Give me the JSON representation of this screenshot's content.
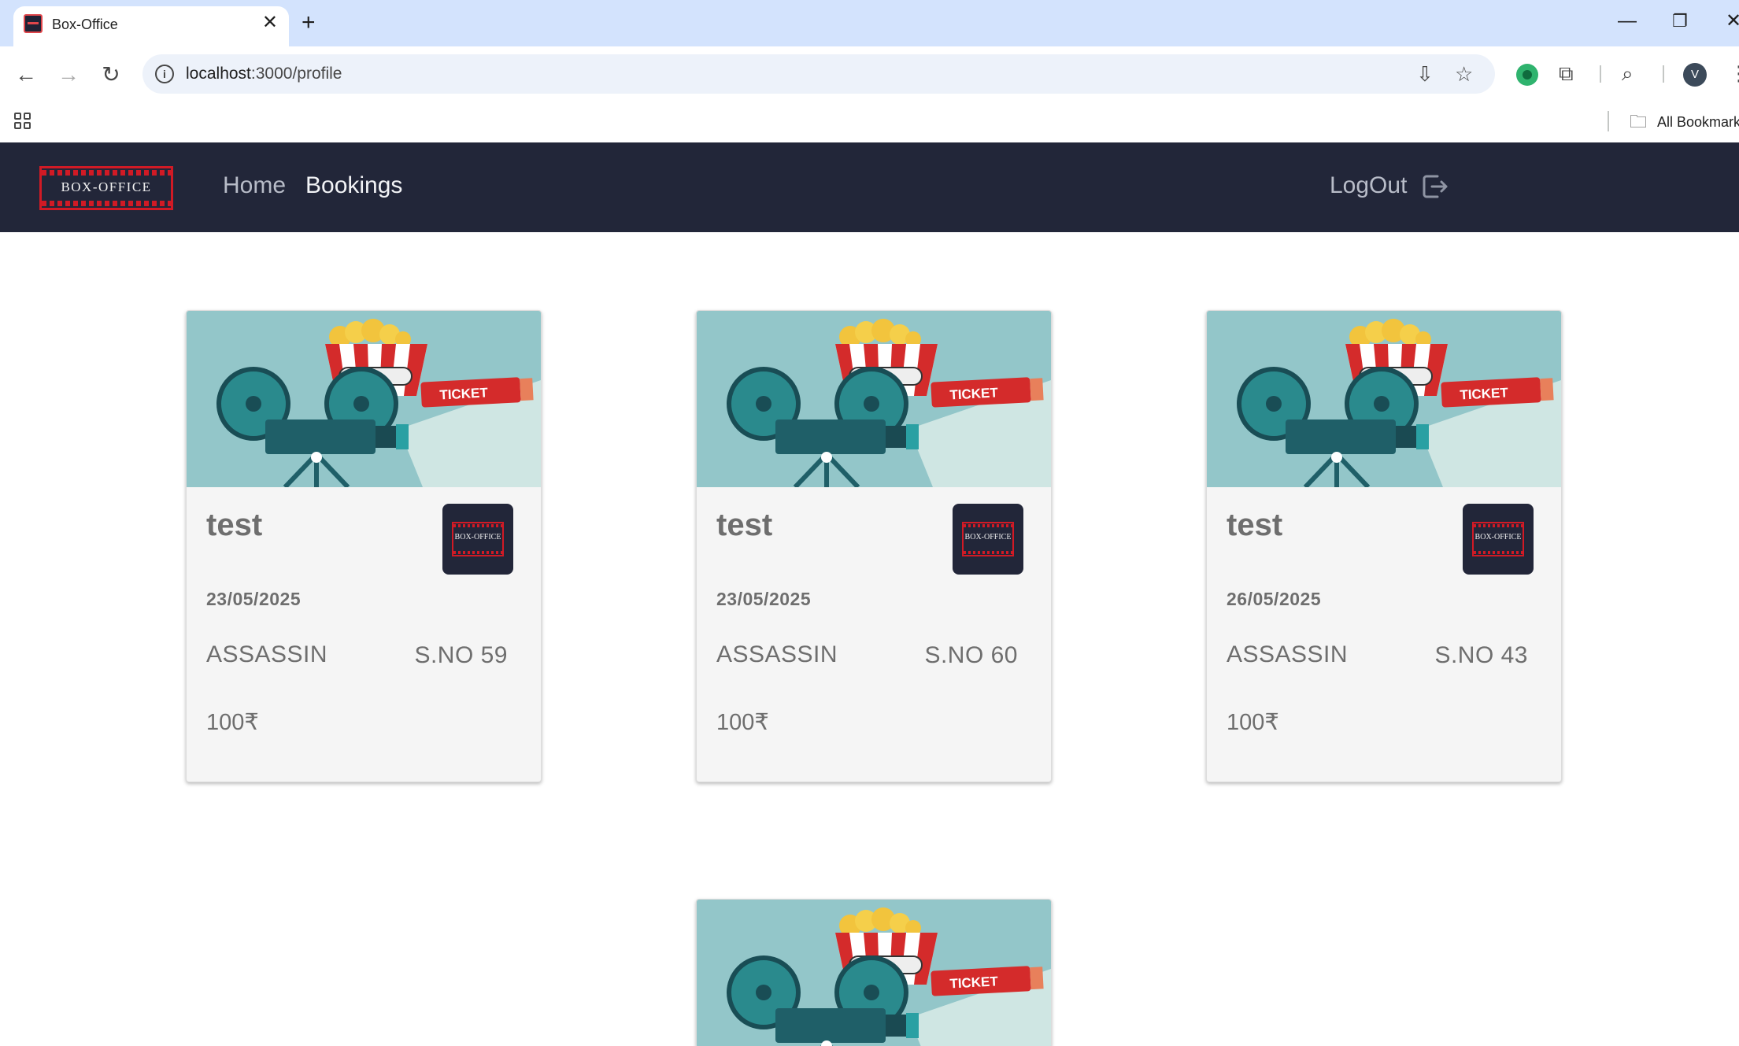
{
  "browser": {
    "tab_title": "Box-Office",
    "tab_close": "✕",
    "new_tab": "+",
    "url_host": "localhost",
    "url_rest": ":3000/profile",
    "all_bookmarks": "All Bookmarks",
    "profile_initial": "V",
    "window_controls": {
      "minimize": "—",
      "restore": "❐",
      "close": "✕"
    }
  },
  "app": {
    "logo_text": "BOX-OFFICE",
    "nav": {
      "home": "Home",
      "bookings": "Bookings"
    },
    "logout_label": "LogOut",
    "colors": {
      "navbar": "#222639",
      "accent": "#d11a25",
      "card_bg": "#f5f5f5",
      "text": "#6e6e6e"
    }
  },
  "bookings": [
    {
      "user": "test",
      "date": "23/05/2025",
      "movie": "ASSASSIN",
      "seat": "S.NO 59",
      "price": "100₹",
      "badge_text": "BOX-OFFICE"
    },
    {
      "user": "test",
      "date": "23/05/2025",
      "movie": "ASSASSIN",
      "seat": "S.NO 60",
      "price": "100₹",
      "badge_text": "BOX-OFFICE"
    },
    {
      "user": "test",
      "date": "26/05/2025",
      "movie": "ASSASSIN",
      "seat": "S.NO 43",
      "price": "100₹",
      "badge_text": "BOX-OFFICE"
    },
    {
      "ticket_label": "TICKET"
    }
  ],
  "card_image": {
    "ticket_label": "TICKET"
  }
}
